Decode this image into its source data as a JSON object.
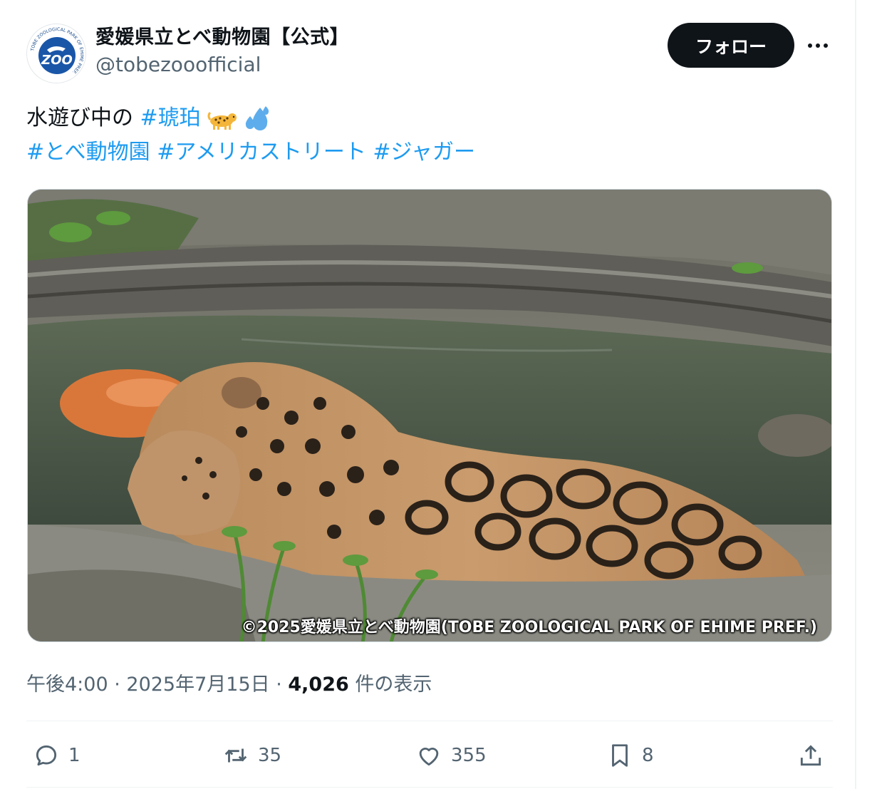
{
  "account": {
    "display_name": "愛媛県立とべ動物園【公式】",
    "handle": "@tobezooofficial",
    "avatar_text": "ZOO",
    "avatar_ring_text": "TOBE ZOOLOGICAL PARK OF EHIME PREF."
  },
  "header": {
    "follow_label": "フォロー",
    "more_icon": "more-horizontal-icon"
  },
  "tweet": {
    "line1_text": "水遊び中の ",
    "line1_hashtag": "#琥珀",
    "line1_emojis": [
      "leopard-emoji",
      "sweat-droplets-emoji"
    ],
    "hashtags": [
      "#とべ動物園",
      "#アメリカストリート",
      "#ジャガー"
    ]
  },
  "media": {
    "caption": "©2025愛媛県立とべ動物園(TOBE ZOOLOGICAL PARK OF EHIME PREF.)"
  },
  "meta": {
    "time": "午後4:00",
    "separator": " · ",
    "date": "2025年7月15日",
    "views_count": "4,026",
    "views_label": " 件の表示"
  },
  "actions": {
    "replies": "1",
    "reposts": "35",
    "likes": "355",
    "bookmarks": "8"
  },
  "colors": {
    "accent": "#1d9bf0",
    "text": "#0f1419",
    "muted": "#536471",
    "button_bg": "#0f1419"
  }
}
